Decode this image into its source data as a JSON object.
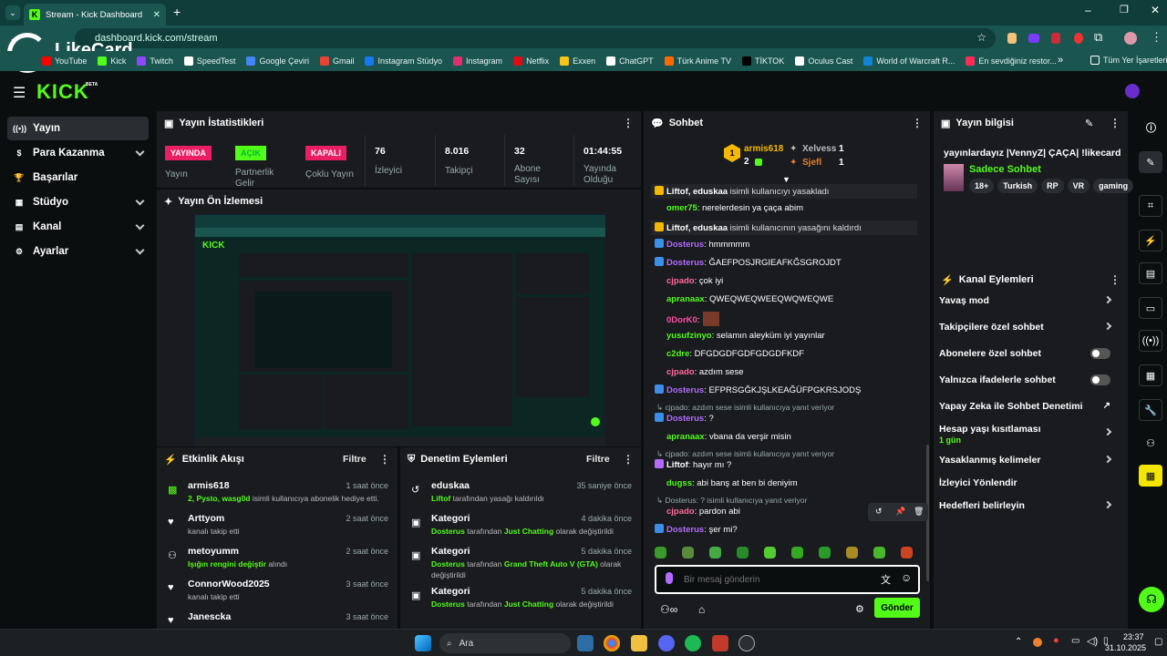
{
  "browser": {
    "tab_title": "Stream - Kick Dashboard",
    "url": "dashboard.kick.com/stream",
    "watermark": "LikeCard",
    "bookmarks": [
      "YouTube",
      "Kick",
      "Twitch",
      "SpeedTest",
      "Google Çeviri",
      "Gmail",
      "Instagram Stüdyo",
      "Instagram",
      "Netflix",
      "Exxen",
      "ChatGPT",
      "Türk Anime TV",
      "TİKTOK",
      "Oculus Cast",
      "World of Warcraft R...",
      "En sevdiğiniz restor..."
    ],
    "all_bookmarks": "Tüm Yer İşaretleri"
  },
  "colors": {
    "brand": "#53fc18",
    "danger": "#e91e63",
    "panel": "#191b1f",
    "bg": "#0b0e0f"
  },
  "nav": {
    "logo": "KICK",
    "beta": "BETA"
  },
  "sidebar": {
    "items": [
      {
        "label": "Yayın",
        "icon": "broadcast-icon"
      },
      {
        "label": "Para Kazanma",
        "icon": "money-icon"
      },
      {
        "label": "Başarılar",
        "icon": "trophy-icon"
      },
      {
        "label": "Stüdyo",
        "icon": "studio-icon"
      },
      {
        "label": "Kanal",
        "icon": "channel-icon"
      },
      {
        "label": "Ayarlar",
        "icon": "settings-icon"
      }
    ]
  },
  "stats": {
    "title": "Yayın İstatistikleri",
    "yayin": {
      "badge": "YAYINDA",
      "label": "Yayın"
    },
    "partner": {
      "badge": "AÇIK",
      "label": "Partnerlik Gelir"
    },
    "coklu": {
      "badge": "KAPALI",
      "label": "Çoklu Yayın"
    },
    "izleyici": {
      "value": "76",
      "label": "İzleyici"
    },
    "takipci": {
      "value": "8.016",
      "label": "Takipçi"
    },
    "abone": {
      "value": "32",
      "label": "Abone Sayısı"
    },
    "sure": {
      "value": "01:44:55",
      "label": "Yayında Olduğu"
    }
  },
  "preview": {
    "title": "Yayın Ön İzlemesi"
  },
  "activity": {
    "title": "Etkinlik Akışı",
    "filter": "Filtre",
    "items": [
      {
        "name": "armis618",
        "time": "1 saat önce",
        "hl": "2, Pysto, wasg0d",
        "desc": " isimli kullanıcıya abonelik hediye etti."
      },
      {
        "name": "Arttyom",
        "time": "2 saat önce",
        "hl": "",
        "desc": "kanalı takip etti"
      },
      {
        "name": "metoyumm",
        "time": "2 saat önce",
        "hl": "Işığın rengini değiştir",
        "desc": " alındı"
      },
      {
        "name": "ConnorWood2025",
        "time": "3 saat önce",
        "hl": "",
        "desc": "kanalı takip etti"
      },
      {
        "name": "Janescka",
        "time": "3 saat önce",
        "hl": "",
        "desc": ""
      }
    ]
  },
  "moderation": {
    "title": "Denetim Eylemleri",
    "filter": "Filtre",
    "items": [
      {
        "name": "eduskaa",
        "time": "35 saniye önce",
        "actor": "Liftof",
        "mid": " tarafından yasağı kaldırıldı",
        "target": "",
        "tail": ""
      },
      {
        "name": "Kategori",
        "time": "4 dakika önce",
        "actor": "Dosterus",
        "mid": " tarafından ",
        "target": "Just Chatting",
        "tail": " olarak değiştirildi"
      },
      {
        "name": "Kategori",
        "time": "5 dakika önce",
        "actor": "Dosterus",
        "mid": " tarafından ",
        "target": "Grand Theft Auto V (GTA)",
        "tail": " olarak değiştirildi"
      },
      {
        "name": "Kategori",
        "time": "5 dakika önce",
        "actor": "Dosterus",
        "mid": " tarafından ",
        "target": "Just Chatting",
        "tail": " olarak değiştirildi"
      }
    ]
  },
  "chat": {
    "title": "Sohbet",
    "leader1": {
      "name": "armis618",
      "count": "2"
    },
    "leader2": {
      "name": "Xelvess",
      "count": "1"
    },
    "leader3": {
      "name": "Sjefl",
      "count": "1"
    },
    "messages": [
      {
        "user": "Liftof, eduskaa",
        "text": " isimli kullanıcıyı yasakladı",
        "color": "#fff",
        "sys": true
      },
      {
        "user": "omer75",
        "text": ": nerelerdesin ya çaça abim",
        "color": "#53fc18"
      },
      {
        "user": "Liftof, eduskaa",
        "text": " isimli kullanıcının yasağını kaldırdı",
        "color": "#fff",
        "sys": true
      },
      {
        "user": "Dosterus",
        "text": ": hmmmmm",
        "color": "#b36bff"
      },
      {
        "user": "Dosterus",
        "text": ": ĞAEFPOSJRGIEAFKĞSGROJDT",
        "color": "#b36bff"
      },
      {
        "user": "cjpado",
        "text": ": çok iyi",
        "color": "#ff6b9a"
      },
      {
        "user": "apranaax",
        "text": ": QWEQWEQWEEQWQWEQWE",
        "color": "#53fc18"
      },
      {
        "user": "0DorK0",
        "text": ":",
        "color": "#ff4fa3"
      },
      {
        "user": "yusufzinyo",
        "text": ": selamın aleyküm iyi yayınlar",
        "color": "#53fc18"
      },
      {
        "user": "c2dre",
        "text": ": DFGDGDFGDFGDGDFKDF",
        "color": "#53fc18"
      },
      {
        "user": "cjpado",
        "text": ": azdım sese",
        "color": "#ff6b9a"
      },
      {
        "user": "Dosterus",
        "text": ": EFPRSGĞKJŞLKEAĞÜFPGKRSJODŞ",
        "color": "#b36bff"
      },
      {
        "user": "",
        "text": "cjpado: azdım sese isimli kullanıcıya yanıt veriyor",
        "color": "#9aa",
        "reply": true
      },
      {
        "user": "Dosterus",
        "text": ": ?",
        "color": "#b36bff"
      },
      {
        "user": "apranaax",
        "text": ": vbana da verşir misin",
        "color": "#53fc18"
      },
      {
        "user": "",
        "text": "cjpado: azdım sese isimli kullanıcıya yanıt veriyor",
        "color": "#9aa",
        "reply": true
      },
      {
        "user": "Liftof",
        "text": ": hayır mı ?",
        "color": "#fff"
      },
      {
        "user": "dugss",
        "text": ": abi banş at ben bi deniyim",
        "color": "#53fc18"
      },
      {
        "user": "",
        "text": "Dosterus: ? isimli kullanıcıya yanıt veriyor",
        "color": "#9aa",
        "reply": true
      },
      {
        "user": "cjpado",
        "text": ": pardon abi",
        "color": "#ff6b9a"
      },
      {
        "user": "Dosterus",
        "text": ": şer mi?",
        "color": "#b36bff"
      }
    ],
    "placeholder": "Bir mesaj gönderin",
    "send": "Gönder"
  },
  "stream_info": {
    "title": "Yayın bilgisi",
    "stream_title": "yayınlardayız |VennyZ| ÇAÇA| !likecard",
    "category": "Sadece Sohbet",
    "tags": [
      "18+",
      "Turkish",
      "RP",
      "VR",
      "gaming"
    ]
  },
  "channel_actions": {
    "title": "Kanal Eylemleri",
    "items": [
      {
        "label": "Yavaş mod",
        "kind": "arrow"
      },
      {
        "label": "Takipçilere özel sohbet",
        "kind": "arrow"
      },
      {
        "label": "Abonelere özel sohbet",
        "kind": "toggle"
      },
      {
        "label": "Yalnızca ifadelerle sohbet",
        "kind": "toggle"
      },
      {
        "label": "Yapay Zeka ile Sohbet Denetimi",
        "kind": "ext"
      },
      {
        "label": "Hesap yaşı kısıtlaması",
        "kind": "arrow",
        "sub": "1 gün"
      },
      {
        "label": "Yasaklanmış kelimeler",
        "kind": "arrow"
      },
      {
        "label": "İzleyici Yönlendir",
        "kind": "none"
      },
      {
        "label": "Hedefleri belirleyin",
        "kind": "arrow"
      }
    ]
  },
  "taskbar": {
    "search": "Ara",
    "time": "23:37",
    "date": "31.10.2025"
  }
}
